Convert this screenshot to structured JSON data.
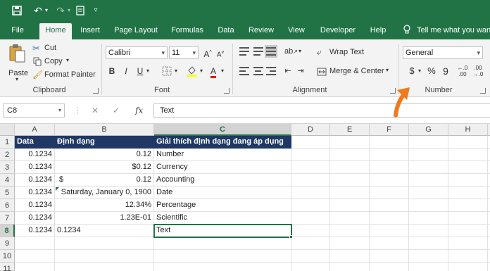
{
  "ribbon": {
    "tabs": [
      "File",
      "Home",
      "Insert",
      "Page Layout",
      "Formulas",
      "Data",
      "Review",
      "View",
      "Developer",
      "Help"
    ],
    "active_tab": "Home",
    "tell_me": "Tell me what you wan",
    "clipboard": {
      "paste": "Paste",
      "cut": "Cut",
      "copy": "Copy",
      "format_painter": "Format Painter",
      "label": "Clipboard"
    },
    "font": {
      "family": "Calibri",
      "size": "11",
      "label": "Font",
      "bold": "B",
      "italic": "I",
      "underline": "U",
      "grow": "A",
      "shrink": "A"
    },
    "alignment": {
      "wrap_text": "Wrap Text",
      "merge_center": "Merge & Center",
      "label": "Alignment"
    },
    "number": {
      "format": "General",
      "currency": "$",
      "percent": "%",
      "comma": "9",
      "label": "Number"
    }
  },
  "formula_bar": {
    "name_box": "C8",
    "fx": "fx",
    "value": "Text"
  },
  "sheet": {
    "columns": [
      "A",
      "B",
      "C",
      "D",
      "E",
      "F",
      "G",
      "H"
    ],
    "rows": [
      "1",
      "2",
      "3",
      "4",
      "5",
      "6",
      "7",
      "8",
      "9",
      "10",
      "11"
    ],
    "header": [
      "Data",
      "Định dạng",
      "Giải thích định dạng đang áp dụng"
    ],
    "data": [
      {
        "a": "0.1234",
        "b": "0.12",
        "b_prefix": "",
        "c": "Number"
      },
      {
        "a": "0.1234",
        "b": "$0.12",
        "b_prefix": "",
        "c": "Currency"
      },
      {
        "a": "0.1234",
        "b": "0.12",
        "b_prefix": "$",
        "c": "Accounting"
      },
      {
        "a": "0.1234",
        "b": "Saturday, January 0, 1900",
        "b_prefix": "",
        "c": "Date"
      },
      {
        "a": "0.1234",
        "b": "12.34%",
        "b_prefix": "",
        "c": "Percentage"
      },
      {
        "a": "0.1234",
        "b": "1.23E-01",
        "b_prefix": "",
        "c": "Scientific"
      },
      {
        "a": "0.1234",
        "b": "0.1234",
        "b_prefix": "",
        "c": "Text"
      }
    ]
  },
  "colors": {
    "excel_green": "#217346",
    "header_fill": "#1f3864",
    "arrow": "#f07a1d"
  }
}
